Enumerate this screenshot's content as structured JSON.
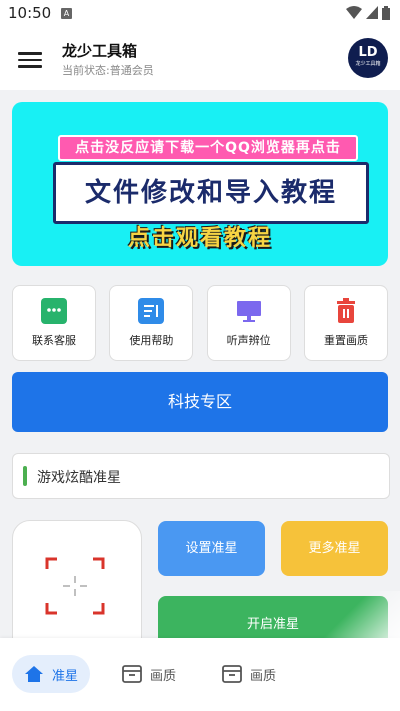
{
  "status_bar": {
    "time": "10:50",
    "notif_letter": "A"
  },
  "app_bar": {
    "title": "龙少工具箱",
    "subtitle": "当前状态:普通会员",
    "logo_big": "LD",
    "logo_small": "龙少工具箱"
  },
  "banner": {
    "top_text": "点击没反应请下载一个QQ浏览器再点击",
    "main_text": "文件修改和导入教程",
    "bottom_text": "点击观看教程"
  },
  "tools": [
    {
      "label": "联系客服",
      "icon": "chat-icon",
      "color": "#27b36c"
    },
    {
      "label": "使用帮助",
      "icon": "document-icon",
      "color": "#2f8be8"
    },
    {
      "label": "听声辨位",
      "icon": "monitor-icon",
      "color": "#7b68ee"
    },
    {
      "label": "重置画质",
      "icon": "trash-icon",
      "color": "#e8453c"
    }
  ],
  "tech_button": "科技专区",
  "game_selector": "游戏炫酷准星",
  "actions": {
    "set": "设置准星",
    "more": "更多准星",
    "start": "开启准星"
  },
  "bottom_nav": [
    {
      "label": "准星",
      "icon": "home-icon",
      "active": true
    },
    {
      "label": "画质",
      "icon": "box-icon",
      "active": false
    },
    {
      "label": "画质",
      "icon": "box-icon",
      "active": false
    }
  ],
  "colors": {
    "primary": "#1e74e8",
    "green": "#3cb45f",
    "yellow": "#f6c23a",
    "banner": "#18f0f4"
  }
}
